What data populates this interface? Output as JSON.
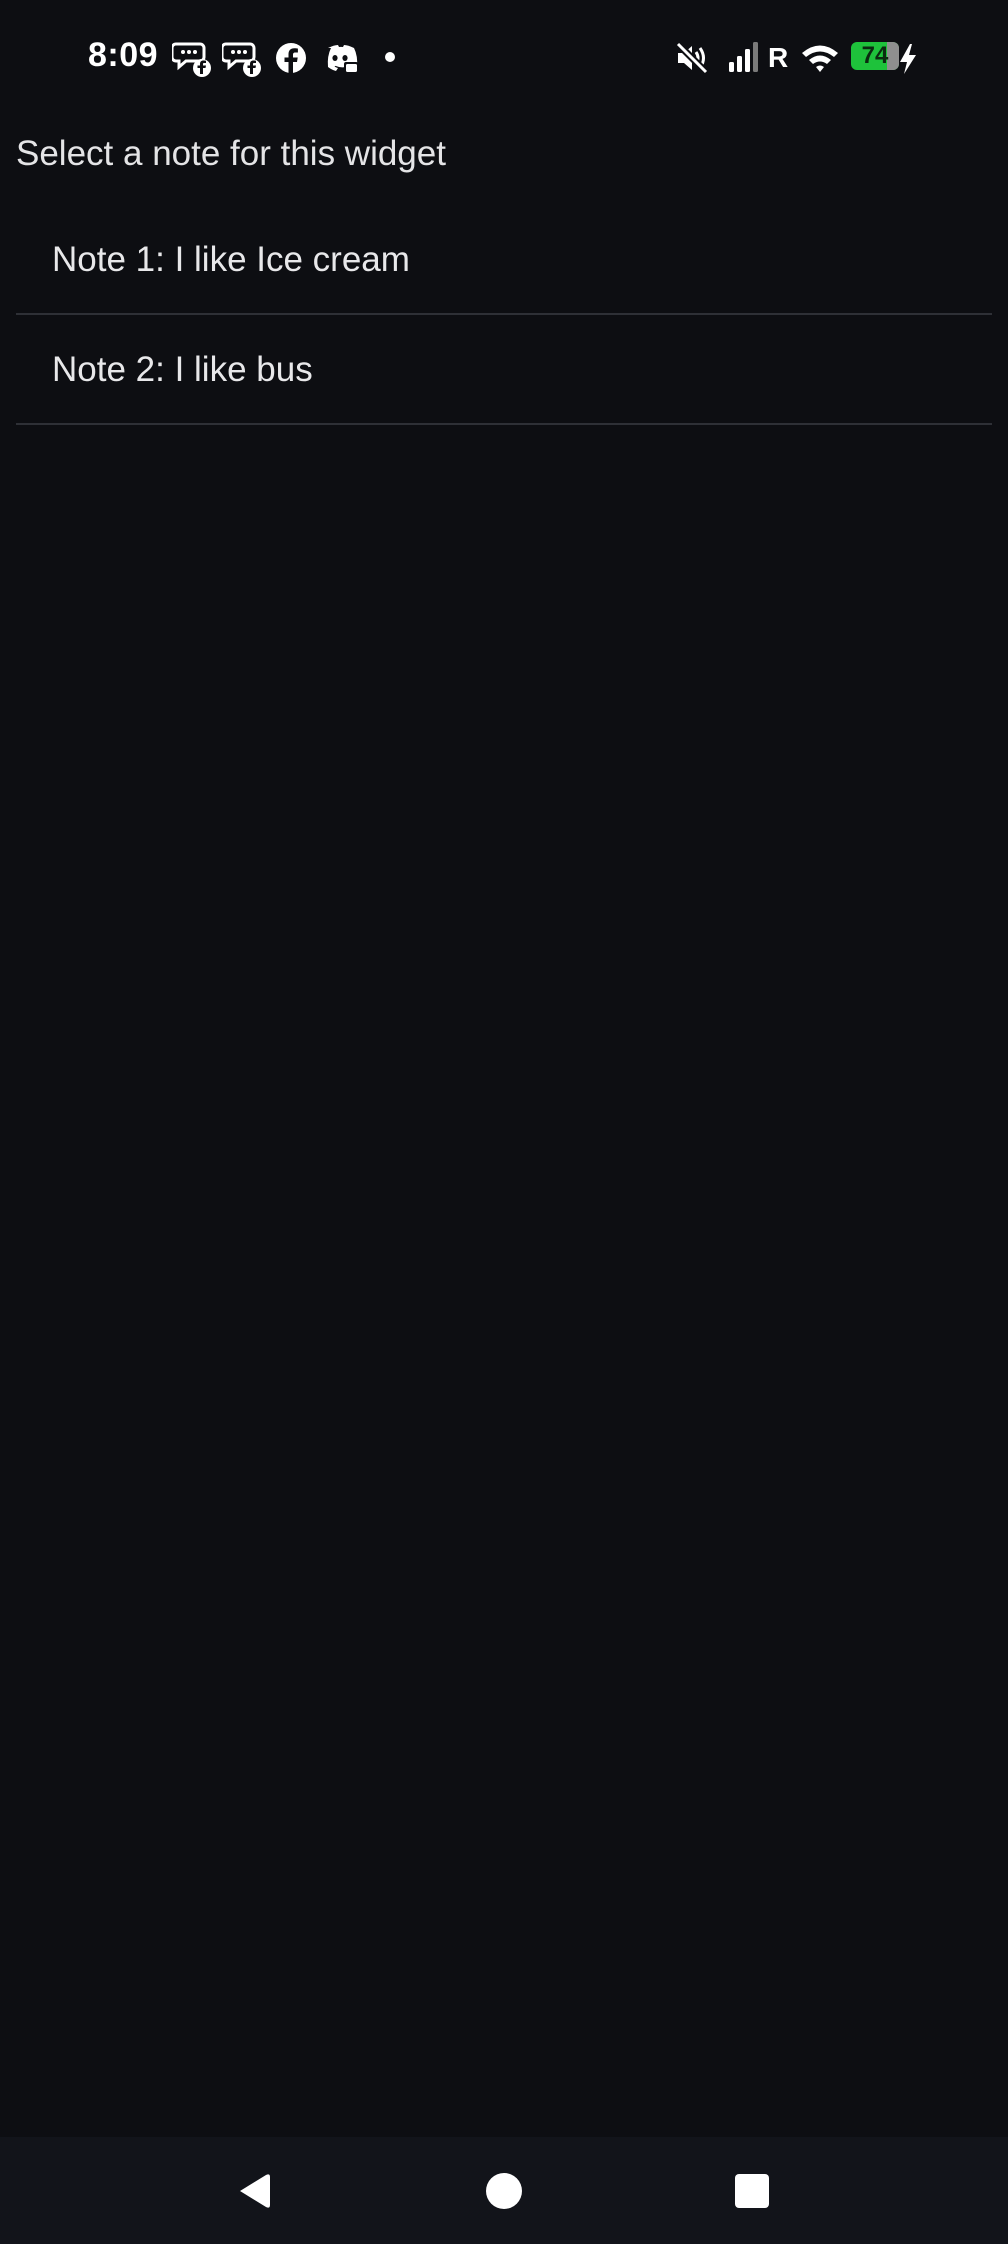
{
  "status_bar": {
    "time": "8:09",
    "left_icons": [
      "messenger-icon",
      "messenger-icon",
      "facebook-icon",
      "discord-icon"
    ],
    "right_icons": [
      "mute-icon",
      "signal-icon",
      "roaming-icon",
      "wifi-icon",
      "battery-icon",
      "charging-icon"
    ],
    "roaming_label": "R",
    "battery_level": "74",
    "battery_fraction": 0.74,
    "battery_color": "#1ec23b"
  },
  "page": {
    "title": "Select a note for this widget"
  },
  "notes": [
    {
      "label": "Note 1: I like Ice cream"
    },
    {
      "label": "Note 2: I like bus"
    }
  ],
  "nav_bar": {
    "buttons": [
      "back-icon",
      "home-icon",
      "recents-icon"
    ]
  }
}
